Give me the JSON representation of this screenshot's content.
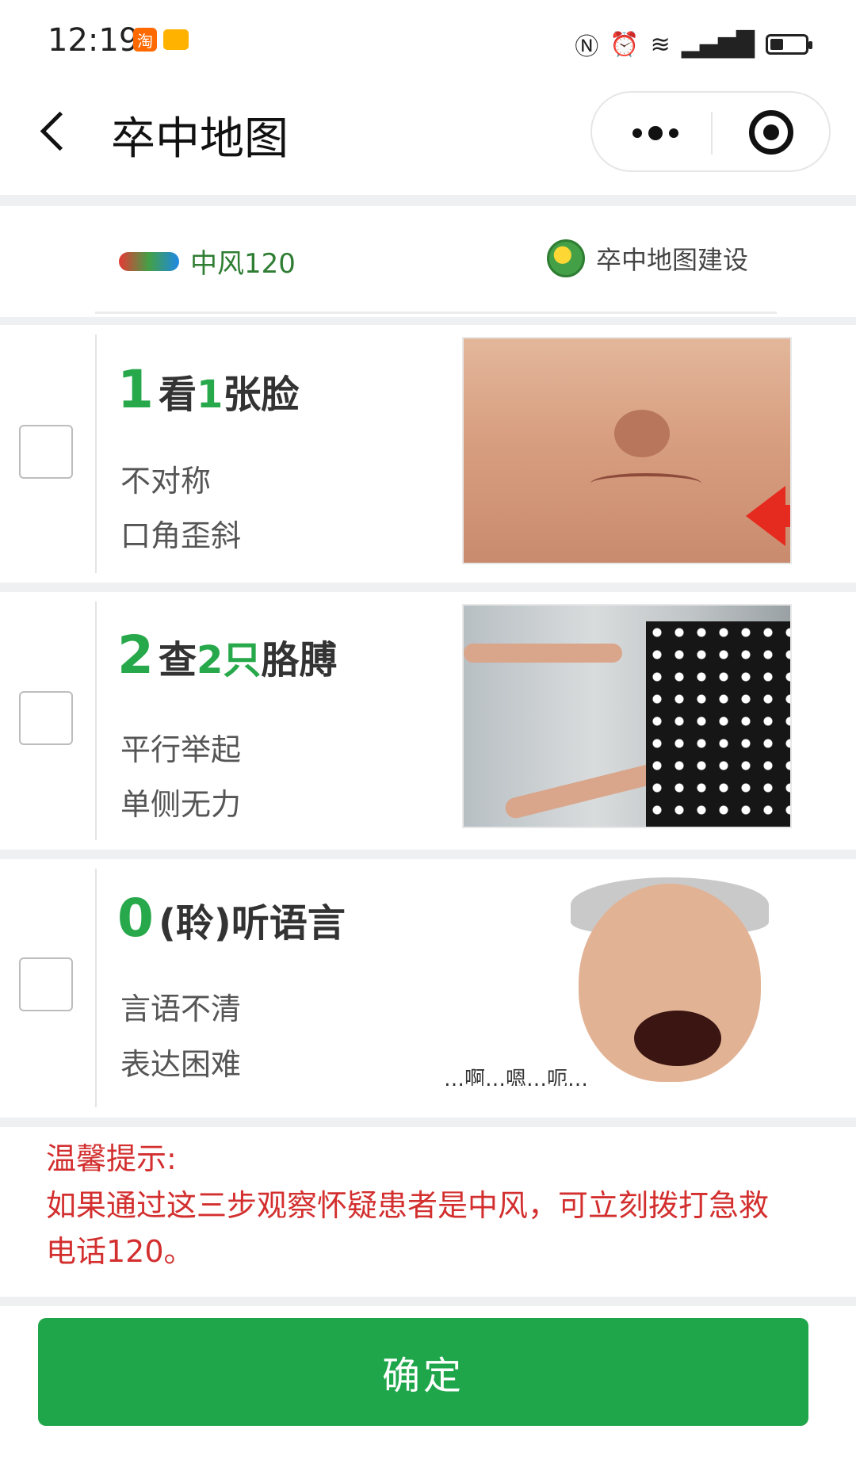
{
  "status_bar": {
    "time": "12:19",
    "notification_icons": [
      "taobao-icon",
      "mail-icon"
    ],
    "system_icons": [
      "nfc-icon",
      "alarm-icon",
      "wifi-icon",
      "signal-4g-icon",
      "battery-icon"
    ],
    "taobao_glyph": "淘"
  },
  "navbar": {
    "title": "卒中地图",
    "back_icon": "chevron-left-icon",
    "more_icon": "more-dots-icon",
    "target_icon": "target-icon"
  },
  "brand": {
    "left_logo_text": "中风120",
    "left_text": "中风120",
    "right_text": "卒中地图建设"
  },
  "steps": [
    {
      "number": "1",
      "title_pre": "看",
      "title_hl": "1",
      "title_post": "张脸",
      "lines": [
        "不对称",
        "口角歪斜"
      ],
      "checked": false
    },
    {
      "number": "2",
      "title_pre": "查",
      "title_hl": "2只",
      "title_post": "胳膊",
      "lines": [
        "平行举起",
        "单侧无力"
      ],
      "checked": false
    },
    {
      "number": "0",
      "title_pre": "(聆)听语言",
      "title_hl": "",
      "title_post": "",
      "lines": [
        "言语不清",
        "表达困难"
      ],
      "image_caption": "…啊…嗯…呃…",
      "checked": false
    }
  ],
  "tip": {
    "title": "温馨提示:",
    "body": "如果通过这三步观察怀疑患者是中风，可立刻拨打急救电话120。"
  },
  "confirm_label": "确定",
  "colors": {
    "accent_green": "#1fa64a",
    "step_green": "#27a84a",
    "tip_red": "#d32f2f",
    "separator": "#eef0f2"
  }
}
